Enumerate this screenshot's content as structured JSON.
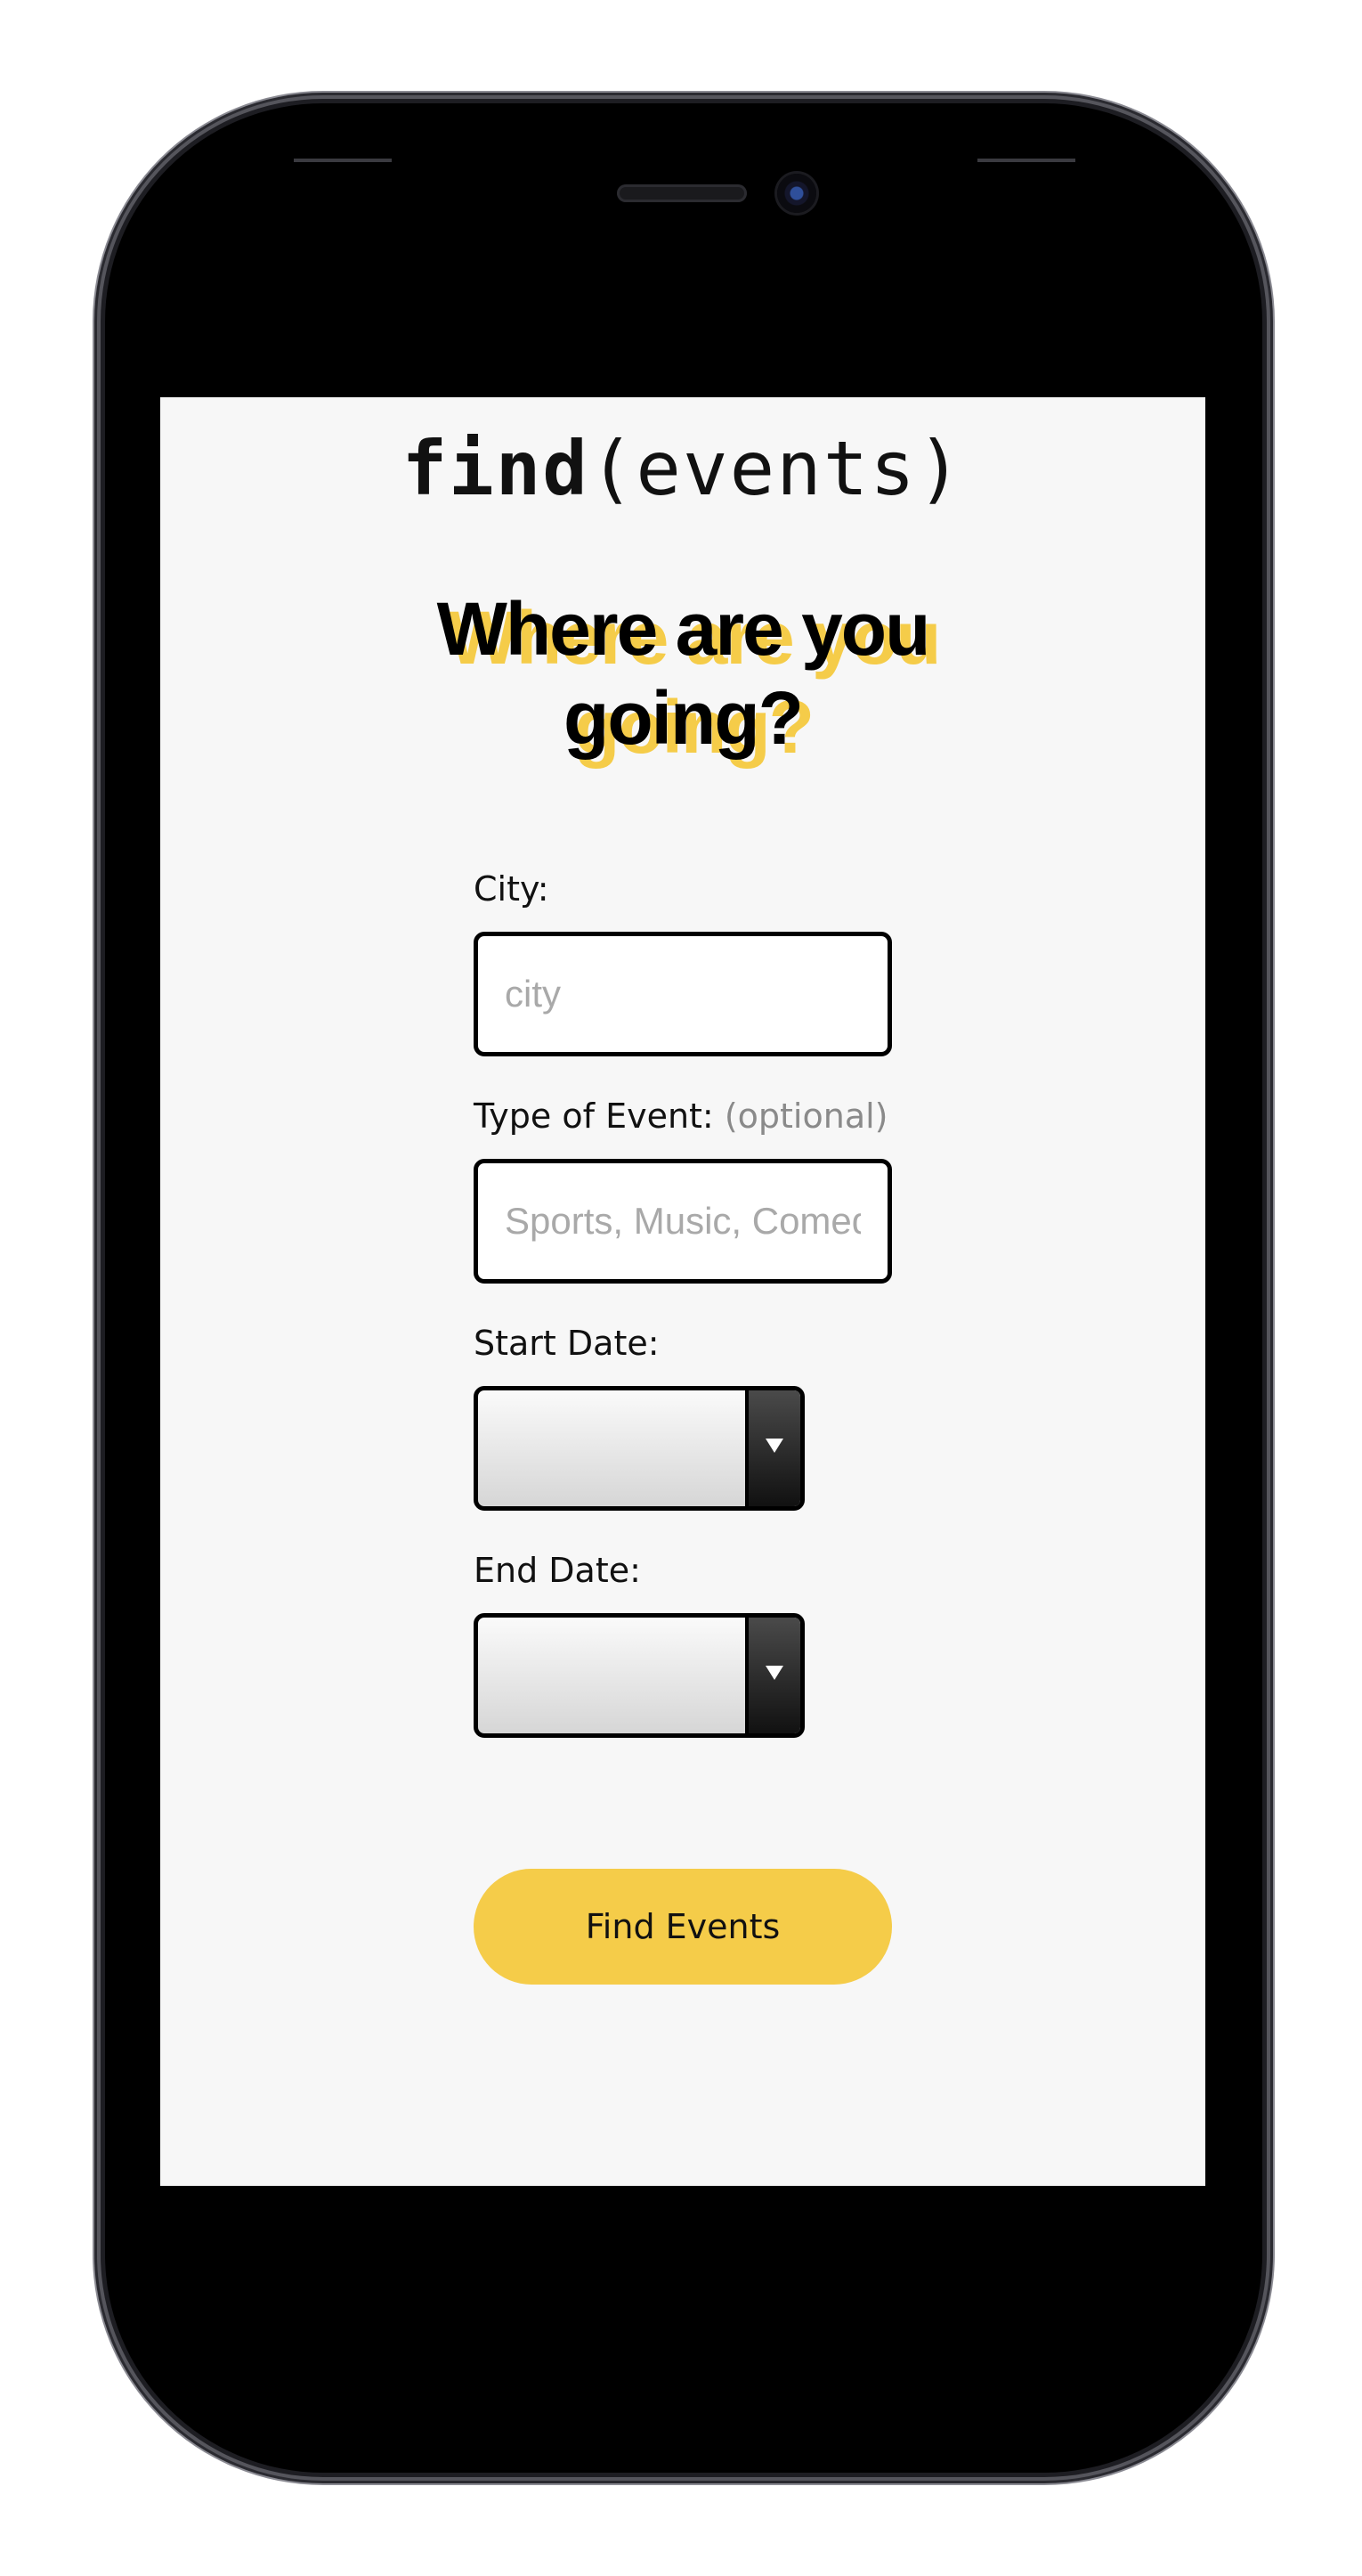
{
  "colors": {
    "accent": "#f5cc49",
    "screen_background": "#f7f7f7",
    "text": "#111111",
    "muted": "#8a8a8a"
  },
  "header": {
    "brand_bold": "find",
    "brand_rest": "(events)"
  },
  "headline": {
    "line1": "Where are you",
    "line2": "going?"
  },
  "form": {
    "city": {
      "label": "City:",
      "value": "",
      "placeholder": "city"
    },
    "event_type": {
      "label": "Type of Event:",
      "optional_label": "(optional)",
      "value": "",
      "placeholder": "Sports, Music, Comedy"
    },
    "start_date": {
      "label": "Start Date:",
      "selected_value": "",
      "icon": "dropdown-arrow-icon"
    },
    "end_date": {
      "label": "End Date:",
      "selected_value": "",
      "icon": "dropdown-arrow-icon"
    },
    "submit_label": "Find Events"
  }
}
